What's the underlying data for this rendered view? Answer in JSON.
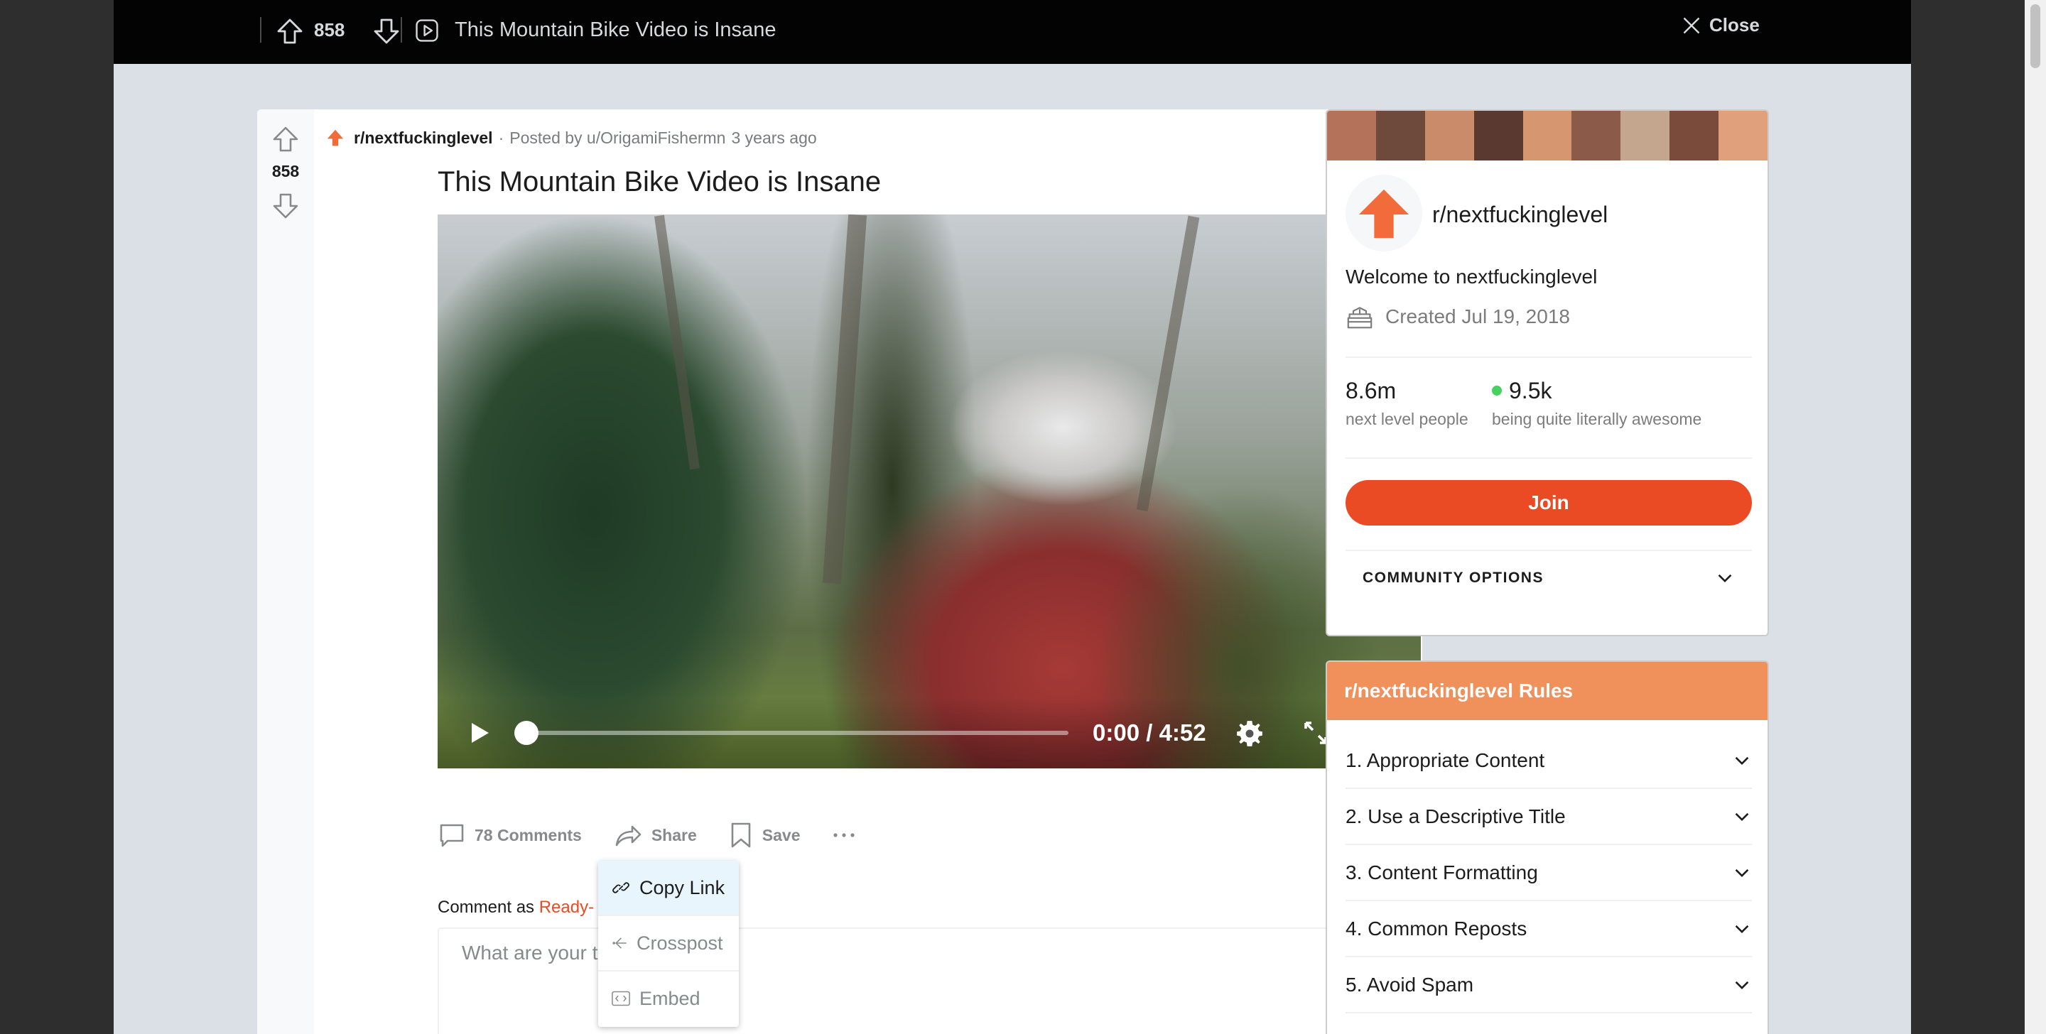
{
  "topbar": {
    "vote_count": "858",
    "title": "This Mountain Bike Video is Insane",
    "close_label": "Close"
  },
  "post": {
    "vote_count": "858",
    "subreddit": "r/nextfuckinglevel",
    "separator": "·",
    "posted_by": "Posted by u/OrigamiFishermn",
    "time_ago": "3 years ago",
    "title": "This Mountain Bike Video is Insane",
    "video": {
      "time": "0:00 / 4:52",
      "progress": 0.0
    },
    "actions": {
      "comments": "78 Comments",
      "share": "Share",
      "save": "Save"
    },
    "comment_as_prefix": "Comment as",
    "comment_user": "Ready-",
    "comment_placeholder": "What are your thoughts?"
  },
  "share_menu": {
    "items": [
      {
        "label": "Copy Link"
      },
      {
        "label": "Crosspost"
      },
      {
        "label": "Embed"
      }
    ]
  },
  "sidebar": {
    "subreddit": "r/nextfuckinglevel",
    "welcome": "Welcome to nextfuckinglevel",
    "created": "Created Jul 19, 2018",
    "members_count": "8.6m",
    "members_label": "next level people",
    "online_count": "9.5k",
    "online_label": "being quite literally awesome",
    "join_label": "Join",
    "community_options": "COMMUNITY OPTIONS",
    "rules_title": "r/nextfuckinglevel Rules",
    "rules": [
      {
        "label": "1. Appropriate Content"
      },
      {
        "label": "2. Use a Descriptive Title"
      },
      {
        "label": "3. Content Formatting"
      },
      {
        "label": "4. Common Reposts"
      },
      {
        "label": "5. Avoid Spam"
      }
    ]
  },
  "colors": {
    "accent": "#ea4b25",
    "rules_header": "#f0905a",
    "online": "#46d160"
  }
}
